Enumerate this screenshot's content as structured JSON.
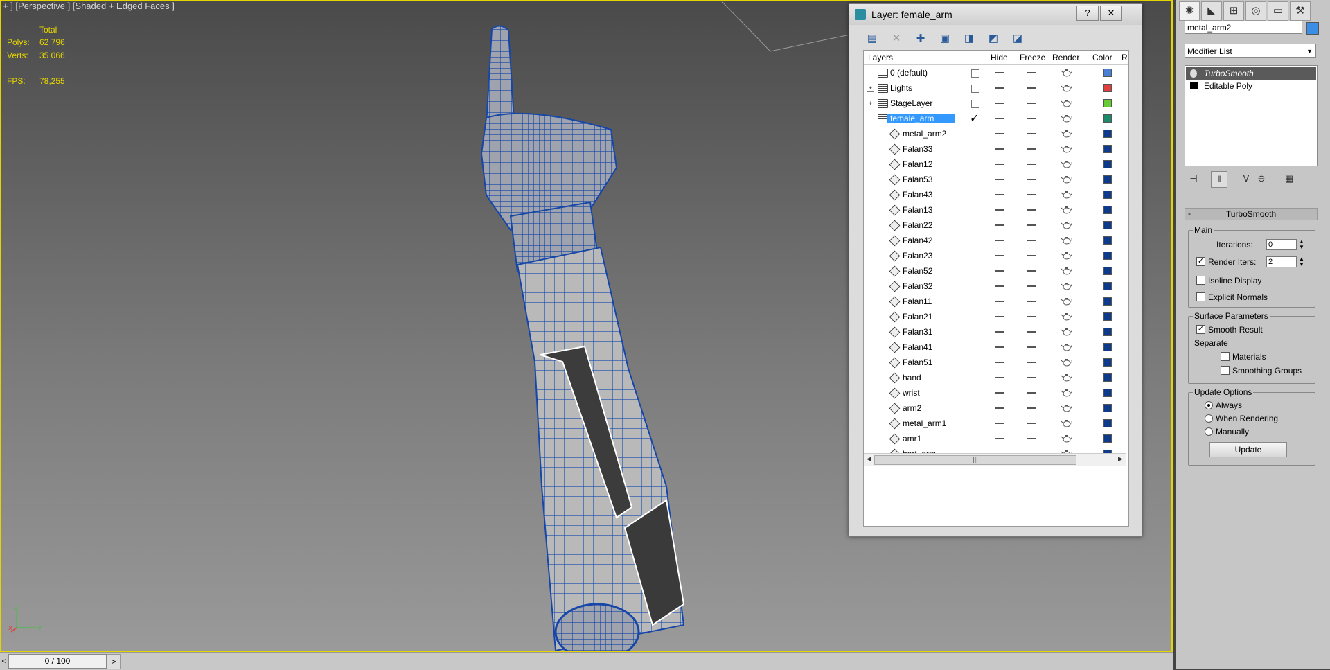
{
  "viewport": {
    "label": "+ ] [Perspective ] [Shaded + Edged Faces ]",
    "stats": {
      "total_label": "Total",
      "polys_label": "Polys:",
      "polys_value": "62 796",
      "verts_label": "Verts:",
      "verts_value": "35 066",
      "fps_label": "FPS:",
      "fps_value": "78,255"
    },
    "axes": {
      "x": "x",
      "y": "y",
      "z": "z"
    }
  },
  "timeline": {
    "prev": "<",
    "position": "0 / 100",
    "next": ">"
  },
  "layer_dialog": {
    "title": "Layer: female_arm",
    "help_btn": "?",
    "close_btn": "✕",
    "columns": {
      "layers": "Layers",
      "hide": "Hide",
      "freeze": "Freeze",
      "render": "Render",
      "color": "Color",
      "r": "R"
    },
    "rows": [
      {
        "name": "0 (default)",
        "kind": "layer",
        "expandable": false,
        "active": false,
        "color": "#4a7fd6",
        "selected": false
      },
      {
        "name": "Lights",
        "kind": "layer",
        "expandable": true,
        "active": false,
        "color": "#e04040",
        "selected": false
      },
      {
        "name": "StageLayer",
        "kind": "layer",
        "expandable": true,
        "active": false,
        "color": "#66cc33",
        "selected": false
      },
      {
        "name": "female_arm",
        "kind": "layer",
        "expandable": false,
        "active": true,
        "color": "#1a8a6a",
        "selected": true
      },
      {
        "name": "metal_arm2",
        "kind": "object",
        "color": "#0d3a8a"
      },
      {
        "name": "Falan33",
        "kind": "object",
        "color": "#0d3a8a"
      },
      {
        "name": "Falan12",
        "kind": "object",
        "color": "#0d3a8a"
      },
      {
        "name": "Falan53",
        "kind": "object",
        "color": "#0d3a8a"
      },
      {
        "name": "Falan43",
        "kind": "object",
        "color": "#0d3a8a"
      },
      {
        "name": "Falan13",
        "kind": "object",
        "color": "#0d3a8a"
      },
      {
        "name": "Falan22",
        "kind": "object",
        "color": "#0d3a8a"
      },
      {
        "name": "Falan42",
        "kind": "object",
        "color": "#0d3a8a"
      },
      {
        "name": "Falan23",
        "kind": "object",
        "color": "#0d3a8a"
      },
      {
        "name": "Falan52",
        "kind": "object",
        "color": "#0d3a8a"
      },
      {
        "name": "Falan32",
        "kind": "object",
        "color": "#0d3a8a"
      },
      {
        "name": "Falan11",
        "kind": "object",
        "color": "#0d3a8a"
      },
      {
        "name": "Falan21",
        "kind": "object",
        "color": "#0d3a8a"
      },
      {
        "name": "Falan31",
        "kind": "object",
        "color": "#0d3a8a"
      },
      {
        "name": "Falan41",
        "kind": "object",
        "color": "#0d3a8a"
      },
      {
        "name": "Falan51",
        "kind": "object",
        "color": "#0d3a8a"
      },
      {
        "name": "hand",
        "kind": "object",
        "color": "#0d3a8a"
      },
      {
        "name": "wrist",
        "kind": "object",
        "color": "#0d3a8a"
      },
      {
        "name": "arm2",
        "kind": "object",
        "color": "#0d3a8a"
      },
      {
        "name": "metal_arm1",
        "kind": "object",
        "color": "#0d3a8a"
      },
      {
        "name": "amr1",
        "kind": "object",
        "color": "#0d3a8a"
      },
      {
        "name": "bart_arm",
        "kind": "object",
        "color": "#0d3a8a"
      }
    ],
    "scroll_grip": "|||"
  },
  "command_panel": {
    "object_name": "metal_arm2",
    "object_color": "#3a8ee6",
    "modifier_list": "Modifier List",
    "stack": [
      {
        "label": "TurboSmooth",
        "selected": true
      },
      {
        "label": "Editable Poly",
        "selected": false
      }
    ],
    "turbosmooth": {
      "title": "TurboSmooth",
      "collapse": "-",
      "main_group": "Main",
      "iterations_label": "Iterations:",
      "iterations_value": "0",
      "render_iters_label": "Render Iters:",
      "render_iters_value": "2",
      "render_iters_checked": true,
      "isoline_label": "Isoline Display",
      "isoline_checked": false,
      "explicit_normals_label": "Explicit Normals",
      "explicit_normals_checked": false,
      "surface_group": "Surface Parameters",
      "smooth_result_label": "Smooth Result",
      "smooth_result_checked": true,
      "separate_label": "Separate",
      "materials_label": "Materials",
      "smoothing_groups_label": "Smoothing Groups",
      "update_group": "Update Options",
      "always_label": "Always",
      "when_rendering_label": "When Rendering",
      "manually_label": "Manually",
      "update_mode": "Always",
      "update_button": "Update"
    }
  }
}
